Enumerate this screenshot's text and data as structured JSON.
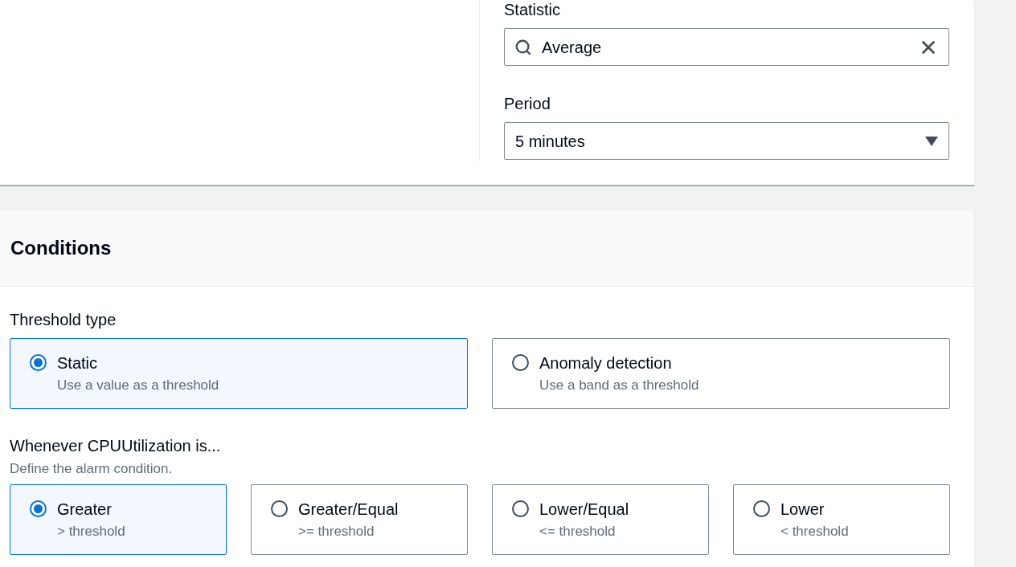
{
  "metric": {
    "statistic": {
      "label": "Statistic",
      "value": "Average"
    },
    "period": {
      "label": "Period",
      "value": "5 minutes"
    }
  },
  "conditions": {
    "title": "Conditions",
    "threshold_type": {
      "label": "Threshold type",
      "options": [
        {
          "label": "Static",
          "description": "Use a value as a threshold",
          "selected": true
        },
        {
          "label": "Anomaly detection",
          "description": "Use a band as a threshold",
          "selected": false
        }
      ]
    },
    "whenever": {
      "label": "Whenever CPUUtilization is...",
      "description": "Define the alarm condition.",
      "options": [
        {
          "label": "Greater",
          "description": "> threshold",
          "selected": true
        },
        {
          "label": "Greater/Equal",
          "description": ">= threshold",
          "selected": false
        },
        {
          "label": "Lower/Equal",
          "description": "<= threshold",
          "selected": false
        },
        {
          "label": "Lower",
          "description": "< threshold",
          "selected": false
        }
      ]
    }
  }
}
